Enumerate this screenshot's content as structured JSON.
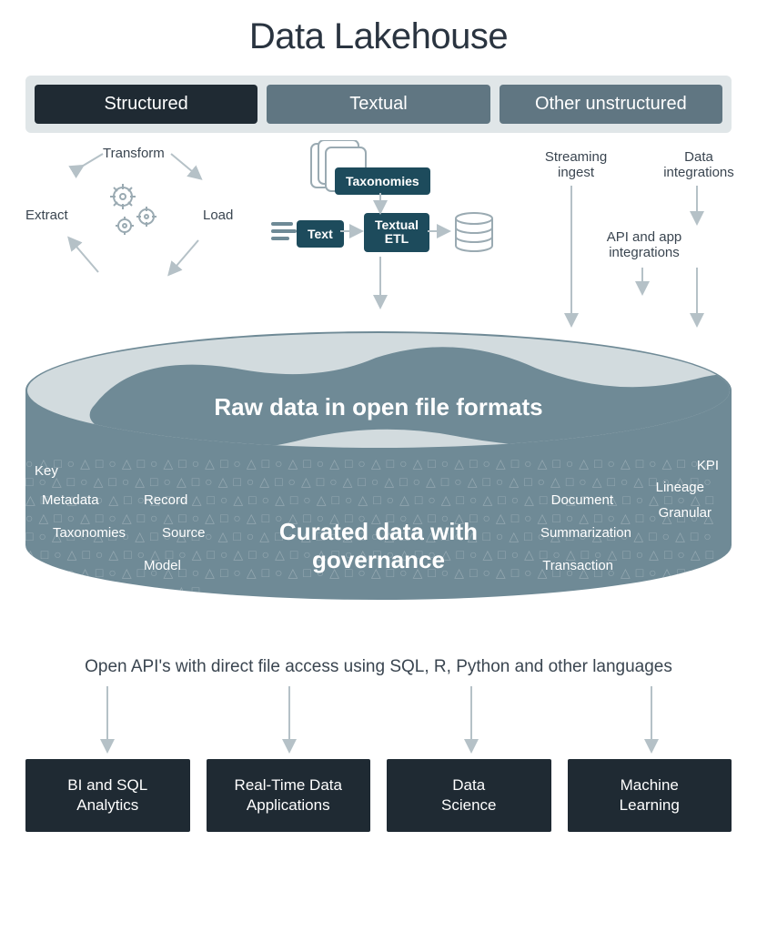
{
  "title": "Data Lakehouse",
  "tabs": [
    "Structured",
    "Textual",
    "Other unstructured"
  ],
  "etl": {
    "transform": "Transform",
    "extract": "Extract",
    "load": "Load"
  },
  "textual": {
    "taxonomies": "Taxonomies",
    "text": "Text",
    "textual_etl": "Textual\nETL"
  },
  "right_ingest": {
    "streaming": "Streaming\ningest",
    "data_int": "Data\nintegrations",
    "api_app": "API and app\nintegrations"
  },
  "lake": {
    "raw": "Raw data in open file formats",
    "curated": "Curated data with\ngovernance",
    "tags_left": [
      "Key",
      "Metadata",
      "Taxonomies",
      "Record",
      "Source",
      "Model"
    ],
    "tags_right": [
      "KPI",
      "Lineage",
      "Granular",
      "Document",
      "Summarization",
      "Transaction"
    ]
  },
  "api_text": "Open API's with direct file access using SQL, R, Python and other languages",
  "outputs": [
    "BI and SQL\nAnalytics",
    "Real-Time Data\nApplications",
    "Data\nScience",
    "Machine\nLearning"
  ]
}
